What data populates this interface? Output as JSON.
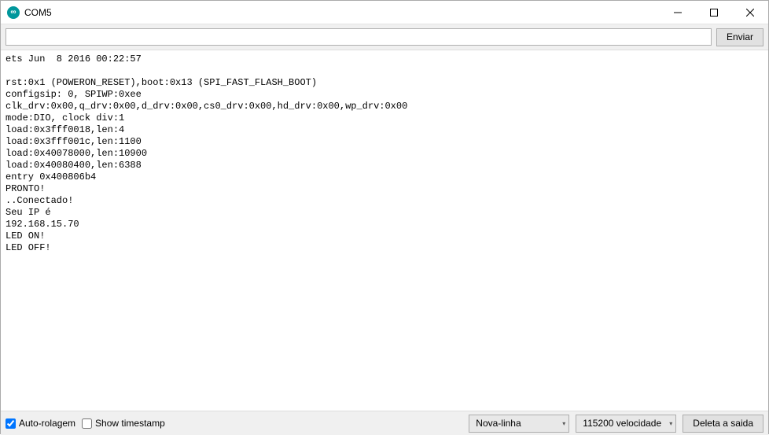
{
  "window": {
    "title": "COM5"
  },
  "toolbar": {
    "input_value": "",
    "send_label": "Enviar"
  },
  "console": {
    "lines": [
      "ets Jun  8 2016 00:22:57",
      "",
      "rst:0x1 (POWERON_RESET),boot:0x13 (SPI_FAST_FLASH_BOOT)",
      "configsip: 0, SPIWP:0xee",
      "clk_drv:0x00,q_drv:0x00,d_drv:0x00,cs0_drv:0x00,hd_drv:0x00,wp_drv:0x00",
      "mode:DIO, clock div:1",
      "load:0x3fff0018,len:4",
      "load:0x3fff001c,len:1100",
      "load:0x40078000,len:10900",
      "load:0x40080400,len:6388",
      "entry 0x400806b4",
      "PRONTO!",
      "..Conectado!",
      "Seu IP é",
      "192.168.15.70",
      "LED ON!",
      "LED OFF!"
    ]
  },
  "bottombar": {
    "autoscroll_label": "Auto-rolagem",
    "autoscroll_checked": true,
    "timestamp_label": "Show timestamp",
    "timestamp_checked": false,
    "line_ending_value": "Nova-linha",
    "baud_value": "115200 velocidade",
    "clear_label": "Deleta a saida"
  }
}
